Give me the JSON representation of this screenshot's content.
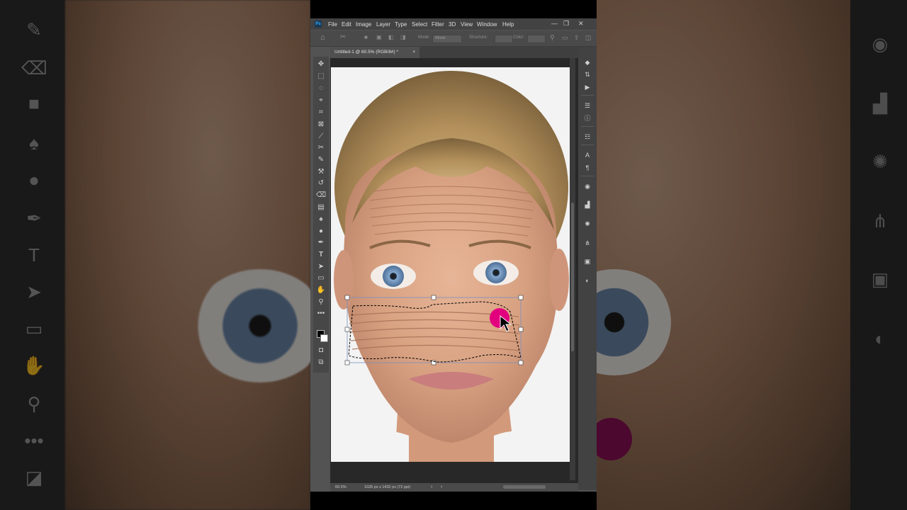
{
  "menu": {
    "app_logo": "Ps",
    "items": [
      "File",
      "Edit",
      "Image",
      "Layer",
      "Type",
      "Select",
      "Filter",
      "3D",
      "View",
      "Window",
      "Help"
    ]
  },
  "window_controls": {
    "minimize": "—",
    "restore": "❐",
    "close": "✕"
  },
  "options_bar": {
    "mode_label": "Mode:",
    "mode_value": "Move",
    "structure_label": "Structure:",
    "color_label": "Color:"
  },
  "document": {
    "tab_title": "Untitled-1 @ 60.5% (RGB/8#) *",
    "tab_close": "×"
  },
  "status": {
    "zoom": "60.5%",
    "info": "1026 px x 1432 px (72 ppi)"
  },
  "colors": {
    "highlight": "#e3007f",
    "panel_bg": "#535353",
    "menubar": "#434343",
    "canvas_bg": "#282828"
  },
  "left_tools": [
    "move-icon",
    "marquee-icon",
    "lasso-icon",
    "quick-select-icon",
    "crop-icon",
    "frame-icon",
    "eyedropper-icon",
    "healing-icon",
    "brush-icon",
    "stamp-icon",
    "history-brush-icon",
    "eraser-icon",
    "gradient-icon",
    "blur-icon",
    "dodge-icon",
    "pen-icon",
    "type-icon",
    "path-select-icon",
    "shape-icon",
    "hand-icon",
    "zoom-icon",
    "more-icon"
  ],
  "right_tools": [
    "layers-icon",
    "channels-icon",
    "play-icon",
    "properties-icon",
    "info-icon",
    "adjust-icon",
    "character-icon",
    "paragraph-icon",
    "color-icon",
    "levels-icon",
    "compass-icon",
    "paths-icon",
    "libraries-icon",
    "navigator-icon"
  ]
}
